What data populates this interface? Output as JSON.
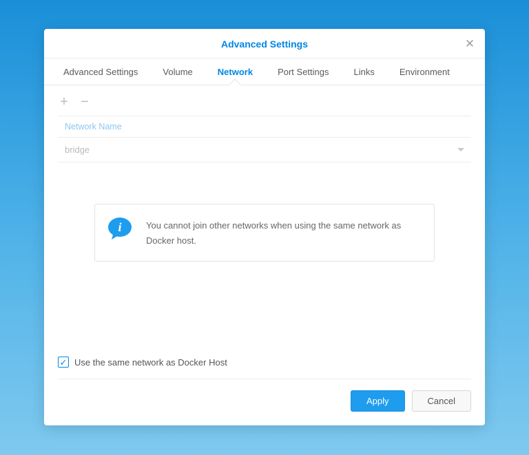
{
  "modal": {
    "title": "Advanced Settings",
    "close_icon": "✕"
  },
  "tabs": {
    "advanced": "Advanced Settings",
    "volume": "Volume",
    "network": "Network",
    "port": "Port Settings",
    "links": "Links",
    "environment": "Environment"
  },
  "toolbar": {
    "add": "+",
    "remove": "−"
  },
  "table": {
    "header": "Network Name",
    "row_value": "bridge"
  },
  "info": {
    "message": "You cannot join other networks when using the same network as Docker host."
  },
  "checkbox": {
    "label": "Use the same network as Docker Host",
    "checked": true
  },
  "footer": {
    "apply": "Apply",
    "cancel": "Cancel"
  }
}
